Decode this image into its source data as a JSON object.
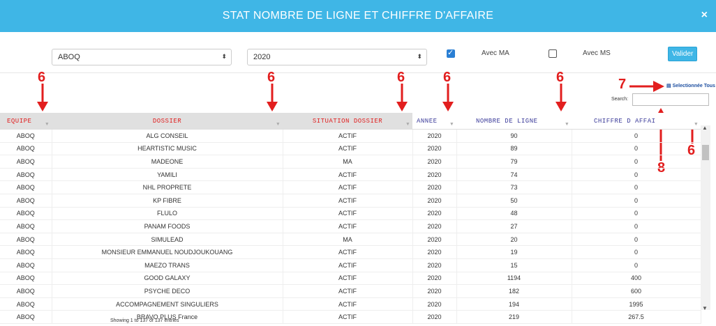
{
  "header": {
    "title": "STAT NOMBRE DE LIGNE ET CHIFFRE D'AFFAIRE",
    "close": "×"
  },
  "filters": {
    "equipe": "ABOQ",
    "annee": "2020",
    "avec_ma_label": "Avec MA",
    "avec_ma_checked": true,
    "avec_ms_label": "Avec MS",
    "avec_ms_checked": false,
    "valider_label": "Valider"
  },
  "annotations": [
    "6",
    "6",
    "6",
    "6",
    "6",
    "7",
    "8",
    "6"
  ],
  "toolbar": {
    "select_all_label": "Selectionnée Tous",
    "search_label": "Search:",
    "search_value": ""
  },
  "table": {
    "columns": [
      "EQUIPE",
      "DOSSIER",
      "SITUATION DOSSIER",
      "ANNEE",
      "NOMBRE DE LIGNE",
      "CHIFFRE D AFFAI"
    ],
    "rows": [
      [
        "ABOQ",
        "ALG CONSEIL",
        "ACTIF",
        "2020",
        "90",
        "0"
      ],
      [
        "ABOQ",
        "HEARTISTIC MUSIC",
        "ACTIF",
        "2020",
        "89",
        "0"
      ],
      [
        "ABOQ",
        "MADEONE",
        "MA",
        "2020",
        "79",
        "0"
      ],
      [
        "ABOQ",
        "YAMILI",
        "ACTIF",
        "2020",
        "74",
        "0"
      ],
      [
        "ABOQ",
        "NHL PROPRETE",
        "ACTIF",
        "2020",
        "73",
        "0"
      ],
      [
        "ABOQ",
        "KP FIBRE",
        "ACTIF",
        "2020",
        "50",
        "0"
      ],
      [
        "ABOQ",
        "FLULO",
        "ACTIF",
        "2020",
        "48",
        "0"
      ],
      [
        "ABOQ",
        "PANAM FOODS",
        "ACTIF",
        "2020",
        "27",
        "0"
      ],
      [
        "ABOQ",
        "SIMULEAD",
        "MA",
        "2020",
        "20",
        "0"
      ],
      [
        "ABOQ",
        "MONSIEUR EMMANUEL NOUDJOUKOUANG",
        "ACTIF",
        "2020",
        "19",
        "0"
      ],
      [
        "ABOQ",
        "MAEZO TRANS",
        "ACTIF",
        "2020",
        "15",
        "0"
      ],
      [
        "ABOQ",
        "GOOD GALAXY",
        "ACTIF",
        "2020",
        "1194",
        "400"
      ],
      [
        "ABOQ",
        "PSYCHE DECO",
        "ACTIF",
        "2020",
        "182",
        "600"
      ],
      [
        "ABOQ",
        "ACCOMPAGNEMENT SINGULIERS",
        "ACTIF",
        "2020",
        "194",
        "1995"
      ],
      [
        "ABOQ",
        "BRAVO PLUS France",
        "ACTIF",
        "2020",
        "219",
        "267.5"
      ]
    ]
  },
  "footer": {
    "info": "Showing 1 to 137 of 137 entries"
  },
  "colors": {
    "header": "#3fb6e6",
    "annotation": "#e21e1e",
    "blue_values": "#2035c8",
    "green_values": "#2a9a2a"
  }
}
